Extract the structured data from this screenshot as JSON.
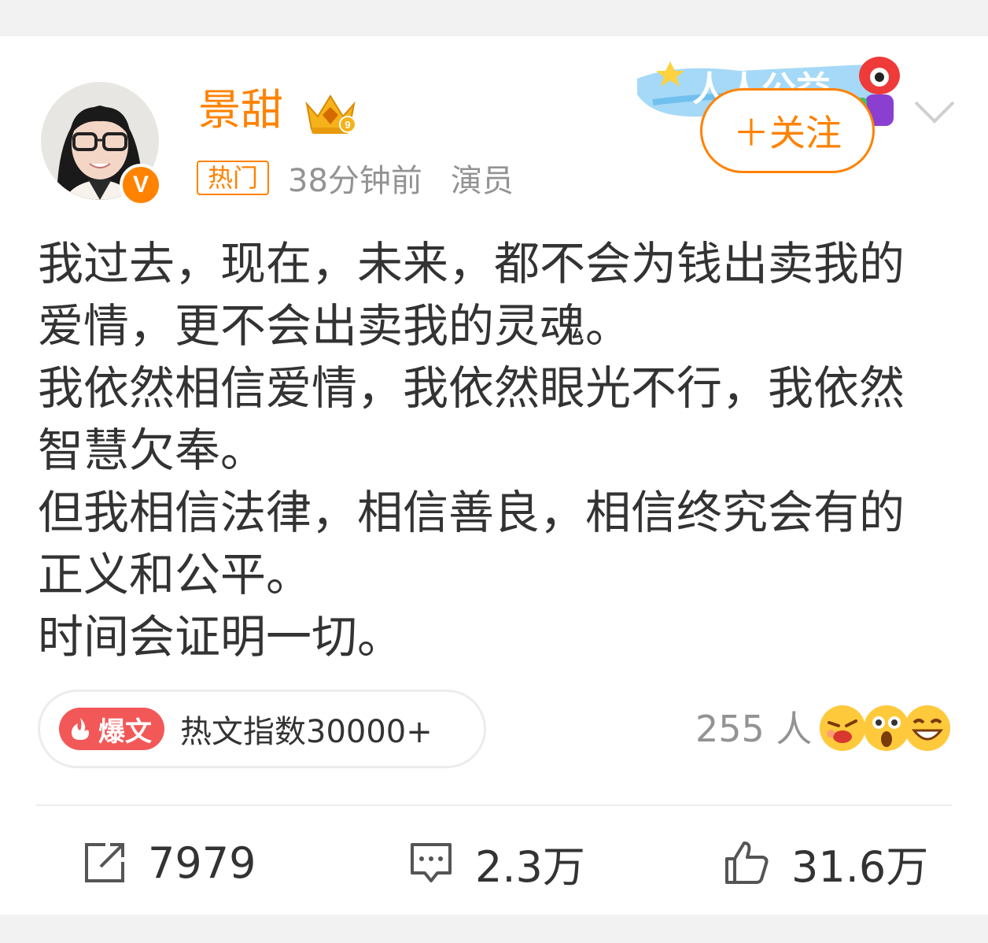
{
  "post": {
    "username": "景甜",
    "hot_tag": "热门",
    "time": "38分钟前",
    "role": "演员",
    "follow_label": "＋关注",
    "banner_text": "人人公益",
    "paragraphs": [
      "我过去，现在，未来，都不会为钱出卖我的",
      "爱情，更不会出卖我的灵魂。",
      "我依然相信爱情，我依然眼光不行，我依然",
      "智慧欠奉。",
      "但我相信法律，相信善良，相信终究会有的",
      "正义和公平。",
      "时间会证明一切。"
    ]
  },
  "hot_index": {
    "badge": "爆文",
    "text": "热文指数30000+"
  },
  "reactions": {
    "count": "255 人",
    "emojis": [
      "smirk-emoji",
      "surprised-emoji",
      "laughing-emoji"
    ]
  },
  "actions": {
    "repost": "7979",
    "comment": "2.3万",
    "like": "31.6万"
  },
  "colors": {
    "accent": "#ff8200",
    "bao": "#f25858",
    "muted": "#939393"
  }
}
